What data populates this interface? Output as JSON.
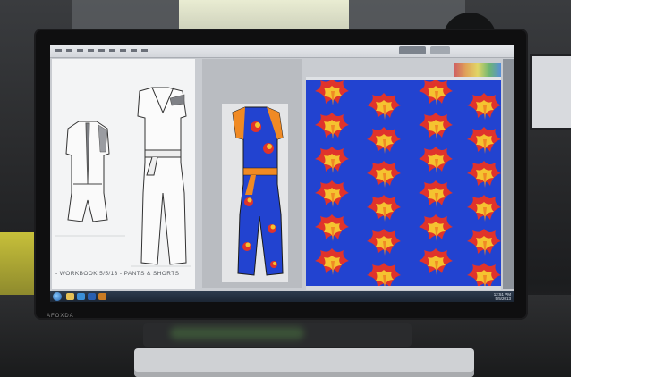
{
  "workbook_label": "- WORKBOOK 5/5/13 - PANTS & SHORTS",
  "monitor_brand": "AFOXDA",
  "clock": {
    "time": "12:51 PM",
    "date": "5/5/2013"
  },
  "colors": {
    "pattern_background": "#2243d0",
    "flower_red": "#e0332b",
    "flower_yellow": "#f5c330",
    "flower_orange": "#f08a24"
  },
  "icons": [
    "start-orb-icon",
    "folder-icon",
    "browser-icon",
    "photoshop-icon",
    "illustrator-icon"
  ]
}
